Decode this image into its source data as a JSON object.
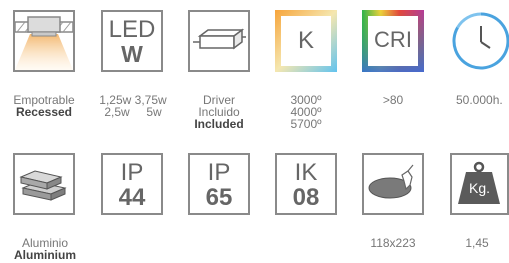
{
  "row1": {
    "recessed": {
      "es": "Empotrable",
      "en": "Recessed"
    },
    "led": {
      "top": "LED",
      "bottom": "W"
    },
    "watts": {
      "line1": "1,25w 3,75w",
      "line2": "2,5w     5w"
    },
    "driver": {
      "line1": "Driver",
      "line2": "Incluido",
      "line3": "Included"
    },
    "k": {
      "symbol": "K",
      "temps": [
        "3000º",
        "4000º",
        "5700º"
      ]
    },
    "cri": {
      "symbol": "CRI",
      "value": ">80"
    },
    "life": {
      "value": "50.000h."
    }
  },
  "row2": {
    "aluminium": {
      "es": "Aluminio",
      "en": "Aluminium"
    },
    "ip44": {
      "top": "IP",
      "bottom": "44"
    },
    "ip65": {
      "top": "IP",
      "bottom": "65"
    },
    "ik08": {
      "top": "IK",
      "bottom": "08"
    },
    "cutout": {
      "value": "118x223"
    },
    "weight": {
      "symbol": "Kg.",
      "value": "1,45"
    }
  },
  "colors": {
    "border": "#8a8a8a",
    "text": "#666666",
    "bold": "#444444",
    "beam": "#f3b870"
  }
}
